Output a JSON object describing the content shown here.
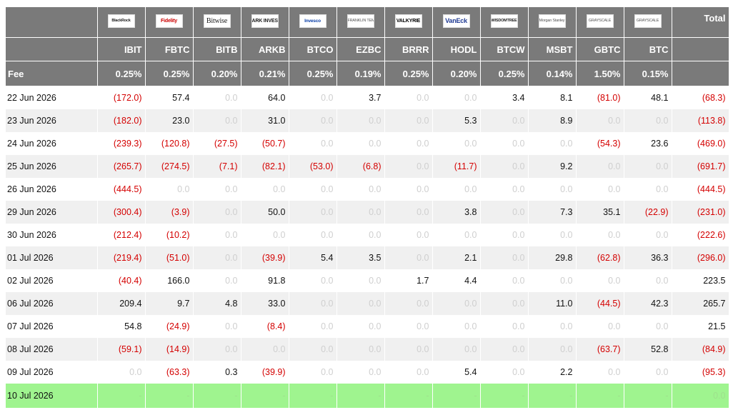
{
  "total_label": "Total",
  "fee_label": "Fee",
  "funds": [
    {
      "logo": "BlackRock",
      "ticker": "IBIT",
      "fee": "0.25%"
    },
    {
      "logo": "Fidelity",
      "ticker": "FBTC",
      "fee": "0.25%"
    },
    {
      "logo": "Bitwise",
      "ticker": "BITB",
      "fee": "0.20%"
    },
    {
      "logo": "ARK INVEST",
      "ticker": "ARKB",
      "fee": "0.21%"
    },
    {
      "logo": "Invesco",
      "ticker": "BTCO",
      "fee": "0.25%"
    },
    {
      "logo": "FRANKLIN TEMPLETON",
      "ticker": "EZBC",
      "fee": "0.19%"
    },
    {
      "logo": "VALKYRIE",
      "ticker": "BRRR",
      "fee": "0.25%"
    },
    {
      "logo": "VanEck",
      "ticker": "HODL",
      "fee": "0.20%"
    },
    {
      "logo": "WISDOMTREE",
      "ticker": "BTCW",
      "fee": "0.25%"
    },
    {
      "logo": "Morgan Stanley",
      "ticker": "MSBT",
      "fee": "0.14%"
    },
    {
      "logo": "GRAYSCALE",
      "ticker": "GBTC",
      "fee": "1.50%"
    },
    {
      "logo": "GRAYSCALE",
      "ticker": "BTC",
      "fee": "0.15%"
    }
  ],
  "rows": [
    {
      "date": "22 Jun 2026",
      "values": [
        "(172.0)",
        "57.4",
        "0.0",
        "64.0",
        "0.0",
        "3.7",
        "0.0",
        "0.0",
        "3.4",
        "8.1",
        "(81.0)",
        "48.1"
      ],
      "total": "(68.3)"
    },
    {
      "date": "23 Jun 2026",
      "values": [
        "(182.0)",
        "23.0",
        "0.0",
        "31.0",
        "0.0",
        "0.0",
        "0.0",
        "5.3",
        "0.0",
        "8.9",
        "0.0",
        "0.0"
      ],
      "total": "(113.8)"
    },
    {
      "date": "24 Jun 2026",
      "values": [
        "(239.3)",
        "(120.8)",
        "(27.5)",
        "(50.7)",
        "0.0",
        "0.0",
        "0.0",
        "0.0",
        "0.0",
        "0.0",
        "(54.3)",
        "23.6"
      ],
      "total": "(469.0)"
    },
    {
      "date": "25 Jun 2026",
      "values": [
        "(265.7)",
        "(274.5)",
        "(7.1)",
        "(82.1)",
        "(53.0)",
        "(6.8)",
        "0.0",
        "(11.7)",
        "0.0",
        "9.2",
        "0.0",
        "0.0"
      ],
      "total": "(691.7)"
    },
    {
      "date": "26 Jun 2026",
      "values": [
        "(444.5)",
        "0.0",
        "0.0",
        "0.0",
        "0.0",
        "0.0",
        "0.0",
        "0.0",
        "0.0",
        "0.0",
        "0.0",
        "0.0"
      ],
      "total": "(444.5)"
    },
    {
      "date": "29 Jun 2026",
      "values": [
        "(300.4)",
        "(3.9)",
        "0.0",
        "50.0",
        "0.0",
        "0.0",
        "0.0",
        "3.8",
        "0.0",
        "7.3",
        "35.1",
        "(22.9)"
      ],
      "total": "(231.0)"
    },
    {
      "date": "30 Jun 2026",
      "values": [
        "(212.4)",
        "(10.2)",
        "0.0",
        "0.0",
        "0.0",
        "0.0",
        "0.0",
        "0.0",
        "0.0",
        "0.0",
        "0.0",
        "0.0"
      ],
      "total": "(222.6)"
    },
    {
      "date": "01 Jul 2026",
      "values": [
        "(219.4)",
        "(51.0)",
        "0.0",
        "(39.9)",
        "5.4",
        "3.5",
        "0.0",
        "2.1",
        "0.0",
        "29.8",
        "(62.8)",
        "36.3"
      ],
      "total": "(296.0)"
    },
    {
      "date": "02 Jul 2026",
      "values": [
        "(40.4)",
        "166.0",
        "0.0",
        "91.8",
        "0.0",
        "0.0",
        "1.7",
        "4.4",
        "0.0",
        "0.0",
        "0.0",
        "0.0"
      ],
      "total": "223.5"
    },
    {
      "date": "06 Jul 2026",
      "values": [
        "209.4",
        "9.7",
        "4.8",
        "33.0",
        "0.0",
        "0.0",
        "0.0",
        "0.0",
        "0.0",
        "11.0",
        "(44.5)",
        "42.3"
      ],
      "total": "265.7"
    },
    {
      "date": "07 Jul 2026",
      "values": [
        "54.8",
        "(24.9)",
        "0.0",
        "(8.4)",
        "0.0",
        "0.0",
        "0.0",
        "0.0",
        "0.0",
        "0.0",
        "0.0",
        "0.0"
      ],
      "total": "21.5"
    },
    {
      "date": "08 Jul 2026",
      "values": [
        "(59.1)",
        "(14.9)",
        "0.0",
        "0.0",
        "0.0",
        "0.0",
        "0.0",
        "0.0",
        "0.0",
        "0.0",
        "(63.7)",
        "52.8"
      ],
      "total": "(84.9)"
    },
    {
      "date": "09 Jul 2026",
      "values": [
        "0.0",
        "(63.3)",
        "0.3",
        "(39.9)",
        "0.0",
        "0.0",
        "0.0",
        "5.4",
        "0.0",
        "2.2",
        "0.0",
        "0.0"
      ],
      "total": "(95.3)"
    }
  ],
  "today_row": {
    "date": "10 Jul 2026",
    "values": [
      "-",
      "-",
      "-",
      "-",
      "-",
      "-",
      "-",
      "-",
      "-",
      "-",
      "-",
      "-"
    ],
    "total": "0.0"
  },
  "colors": {
    "header_bg": "#7a7a7a",
    "negative": "#d40000",
    "zero": "#cfcfcf",
    "today_bg": "#9ff48f",
    "stripe": "#f0f0f0"
  }
}
